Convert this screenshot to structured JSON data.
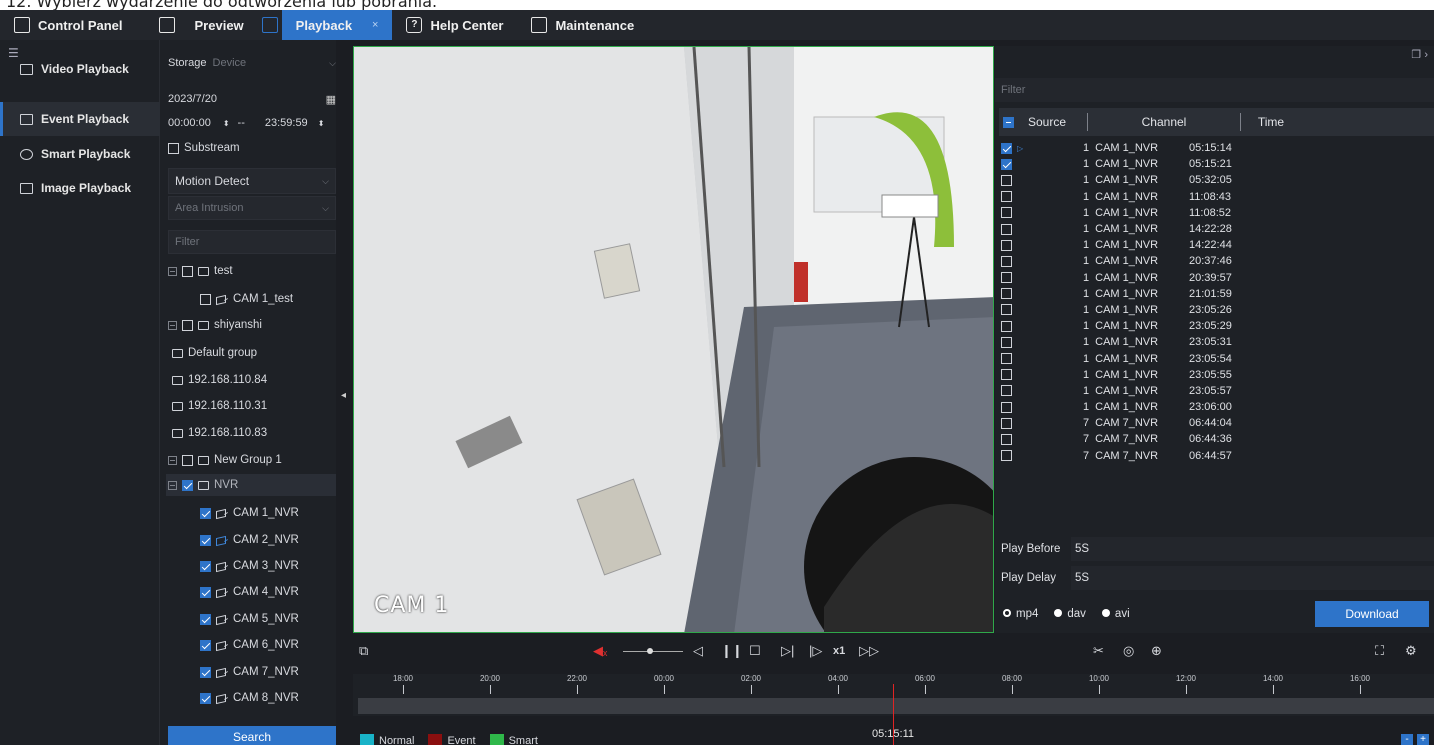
{
  "instruction": "12. Wybierz wydarzenie do odtworzenia lub pobrania.",
  "menu": [
    {
      "label": "Control Panel",
      "icon": "grid-icon"
    },
    {
      "label": "Preview",
      "icon": "monitor-icon"
    },
    {
      "label": "Playback",
      "icon": "playback-icon",
      "active": true,
      "close": "×"
    },
    {
      "label": "Help Center",
      "icon": "help-icon"
    },
    {
      "label": "Maintenance",
      "icon": "maintenance-icon"
    }
  ],
  "leftnav": {
    "items": [
      {
        "label": "Video Playback"
      },
      {
        "label": "Event Playback",
        "active": true
      },
      {
        "label": "Smart Playback"
      },
      {
        "label": "Image Playback"
      }
    ]
  },
  "filters": {
    "storage_label": "Storage",
    "storage_value": "Device",
    "date": "2023/7/20",
    "time_start": "00:00:00",
    "time_sep": "--",
    "time_end": "23:59:59",
    "substream_label": "Substream",
    "event_type": "Motion Detect",
    "event_subtype": "Area Intrusion",
    "filter_placeholder": "Filter",
    "search_button": "Search"
  },
  "tree": [
    {
      "label": "test",
      "level": 0,
      "kind": "group"
    },
    {
      "label": "CAM 1_test",
      "level": 1,
      "kind": "cam"
    },
    {
      "label": "shiyanshi",
      "level": 0,
      "kind": "group"
    },
    {
      "label": "Default group",
      "level": 0,
      "kind": "folder"
    },
    {
      "label": "192.168.110.84",
      "level": 0,
      "kind": "folder"
    },
    {
      "label": "192.168.110.31",
      "level": 0,
      "kind": "folder"
    },
    {
      "label": "192.168.110.83",
      "level": 0,
      "kind": "folder"
    },
    {
      "label": "New Group 1",
      "level": 0,
      "kind": "group"
    },
    {
      "label": "NVR",
      "level": 0,
      "kind": "group",
      "checked": true,
      "selected": true
    },
    {
      "label": "CAM 1_NVR",
      "level": 1,
      "kind": "cam",
      "checked": true
    },
    {
      "label": "CAM 2_NVR",
      "level": 1,
      "kind": "cam",
      "checked": true
    },
    {
      "label": "CAM 3_NVR",
      "level": 1,
      "kind": "cam",
      "checked": true
    },
    {
      "label": "CAM 4_NVR",
      "level": 1,
      "kind": "cam",
      "checked": true
    },
    {
      "label": "CAM 5_NVR",
      "level": 1,
      "kind": "cam",
      "checked": true
    },
    {
      "label": "CAM 6_NVR",
      "level": 1,
      "kind": "cam",
      "checked": true
    },
    {
      "label": "CAM 7_NVR",
      "level": 1,
      "kind": "cam",
      "checked": true
    },
    {
      "label": "CAM 8_NVR",
      "level": 1,
      "kind": "cam",
      "checked": true
    }
  ],
  "video": {
    "osd": "CAM 1"
  },
  "events": {
    "filter_placeholder": "Filter",
    "columns": [
      "Source",
      "Channel",
      "Time"
    ],
    "rows": [
      {
        "source": "1",
        "channel": "CAM 1_NVR",
        "time": "05:15:14",
        "checked": true,
        "playing": true
      },
      {
        "source": "1",
        "channel": "CAM 1_NVR",
        "time": "05:15:21",
        "checked": true
      },
      {
        "source": "1",
        "channel": "CAM 1_NVR",
        "time": "05:32:05"
      },
      {
        "source": "1",
        "channel": "CAM 1_NVR",
        "time": "11:08:43"
      },
      {
        "source": "1",
        "channel": "CAM 1_NVR",
        "time": "11:08:52"
      },
      {
        "source": "1",
        "channel": "CAM 1_NVR",
        "time": "14:22:28"
      },
      {
        "source": "1",
        "channel": "CAM 1_NVR",
        "time": "14:22:44"
      },
      {
        "source": "1",
        "channel": "CAM 1_NVR",
        "time": "20:37:46"
      },
      {
        "source": "1",
        "channel": "CAM 1_NVR",
        "time": "20:39:57"
      },
      {
        "source": "1",
        "channel": "CAM 1_NVR",
        "time": "21:01:59"
      },
      {
        "source": "1",
        "channel": "CAM 1_NVR",
        "time": "23:05:26"
      },
      {
        "source": "1",
        "channel": "CAM 1_NVR",
        "time": "23:05:29"
      },
      {
        "source": "1",
        "channel": "CAM 1_NVR",
        "time": "23:05:31"
      },
      {
        "source": "1",
        "channel": "CAM 1_NVR",
        "time": "23:05:54"
      },
      {
        "source": "1",
        "channel": "CAM 1_NVR",
        "time": "23:05:55"
      },
      {
        "source": "1",
        "channel": "CAM 1_NVR",
        "time": "23:05:57"
      },
      {
        "source": "1",
        "channel": "CAM 1_NVR",
        "time": "23:06:00"
      },
      {
        "source": "7",
        "channel": "CAM 7_NVR",
        "time": "06:44:04"
      },
      {
        "source": "7",
        "channel": "CAM 7_NVR",
        "time": "06:44:36"
      },
      {
        "source": "7",
        "channel": "CAM 7_NVR",
        "time": "06:44:57"
      }
    ],
    "play_before_label": "Play Before",
    "play_before_value": "5S",
    "play_delay_label": "Play Delay",
    "play_delay_value": "5S",
    "formats": [
      {
        "label": "mp4",
        "selected": true
      },
      {
        "label": "dav"
      },
      {
        "label": "avi"
      }
    ],
    "download_button": "Download"
  },
  "controls": {
    "speed": "x1"
  },
  "timeline": {
    "ticks": [
      "18:00",
      "20:00",
      "22:00",
      "00:00",
      "02:00",
      "04:00",
      "06:00",
      "08:00",
      "10:00",
      "12:00",
      "14:00",
      "16:00"
    ],
    "current_time": "05:15:11",
    "legend": [
      {
        "label": "Normal",
        "color": "#19b3c8"
      },
      {
        "label": "Event",
        "color": "#8b0f0f"
      },
      {
        "label": "Smart",
        "color": "#2fb84a"
      }
    ],
    "zoom_out": "-",
    "zoom_in": "+"
  },
  "colors": {
    "accent": "#2e74c9",
    "video_border": "#2fa84a",
    "needle": "#e02424"
  }
}
